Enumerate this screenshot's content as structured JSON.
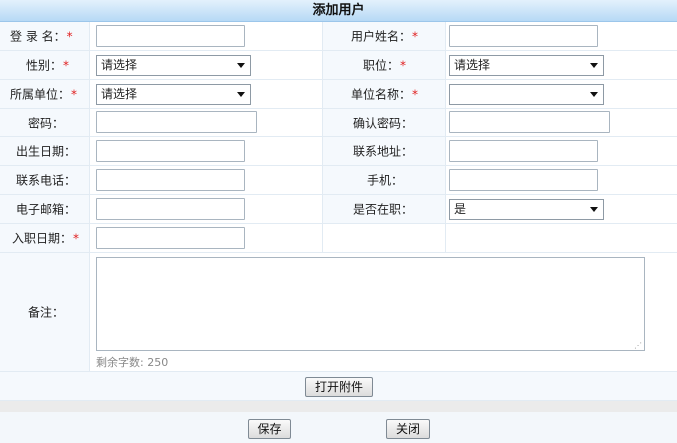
{
  "title": "添加用户",
  "form": {
    "login_name": {
      "label": "登 录 名：",
      "required": "*",
      "value": ""
    },
    "real_name": {
      "label": "用户姓名：",
      "required": "*",
      "value": ""
    },
    "gender": {
      "label": "性别：",
      "required": "*",
      "selected": "请选择"
    },
    "position": {
      "label": "职位：",
      "required": "*",
      "selected": "请选择"
    },
    "unit": {
      "label": "所属单位：",
      "required": "*",
      "selected": "请选择"
    },
    "unit_name": {
      "label": "单位名称：",
      "required": "*",
      "selected": ""
    },
    "password": {
      "label": "密码：",
      "value": ""
    },
    "confirm_password": {
      "label": "确认密码：",
      "value": ""
    },
    "birth_date": {
      "label": "出生日期：",
      "value": ""
    },
    "address": {
      "label": "联系地址：",
      "value": ""
    },
    "phone": {
      "label": "联系电话：",
      "value": ""
    },
    "mobile": {
      "label": "手机：",
      "value": ""
    },
    "email": {
      "label": "电子邮箱：",
      "value": ""
    },
    "employed": {
      "label": "是否在职：",
      "selected": "是"
    },
    "hire_date": {
      "label": "入职日期：",
      "required": "*",
      "value": ""
    },
    "remarks": {
      "label": "备注：",
      "value": "",
      "remaining": "剩余字数: 250"
    }
  },
  "buttons": {
    "attach": "打开附件",
    "save": "保存",
    "close": "关闭"
  },
  "icons": {
    "dropdown": "chevron-down-icon",
    "resize": "resize-grip-icon"
  }
}
